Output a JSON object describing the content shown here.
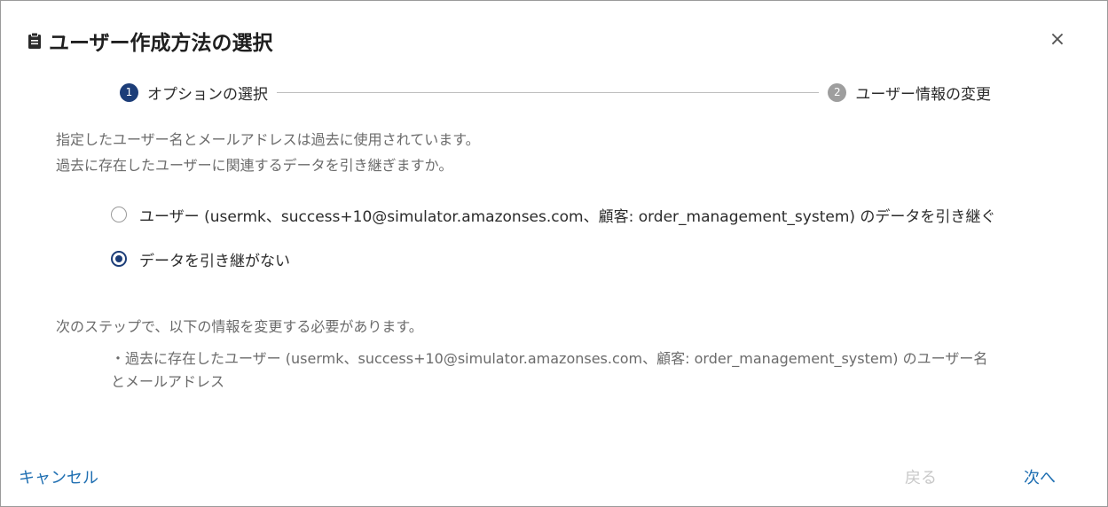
{
  "dialog": {
    "title": "ユーザー作成方法の選択",
    "title_icon": "clipboard-icon",
    "close_label": "×"
  },
  "stepper": {
    "steps": [
      {
        "number": "1",
        "label": "オプションの選択",
        "state": "active"
      },
      {
        "number": "2",
        "label": "ユーザー情報の変更",
        "state": "inactive"
      }
    ]
  },
  "intro": {
    "line1": "指定したユーザー名とメールアドレスは過去に使用されています。",
    "line2": "過去に存在したユーザーに関連するデータを引き継ぎますか。"
  },
  "options": [
    {
      "label": "ユーザー (usermk、success+10@simulator.amazonses.com、顧客: order_management_system) のデータを引き継ぐ",
      "checked": false
    },
    {
      "label": "データを引き継がない",
      "checked": true
    }
  ],
  "notice": {
    "heading": "次のステップで、以下の情報を変更する必要があります。",
    "item": "・過去に存在したユーザー (usermk、success+10@simulator.amazonses.com、顧客: order_management_system) のユーザー名とメールアドレス"
  },
  "footer": {
    "cancel_label": "キャンセル",
    "back_label": "戻る",
    "next_label": "次へ"
  },
  "colors": {
    "accent": "#1c3d78",
    "link": "#1f6fb2",
    "disabled": "#c8c8c8"
  }
}
